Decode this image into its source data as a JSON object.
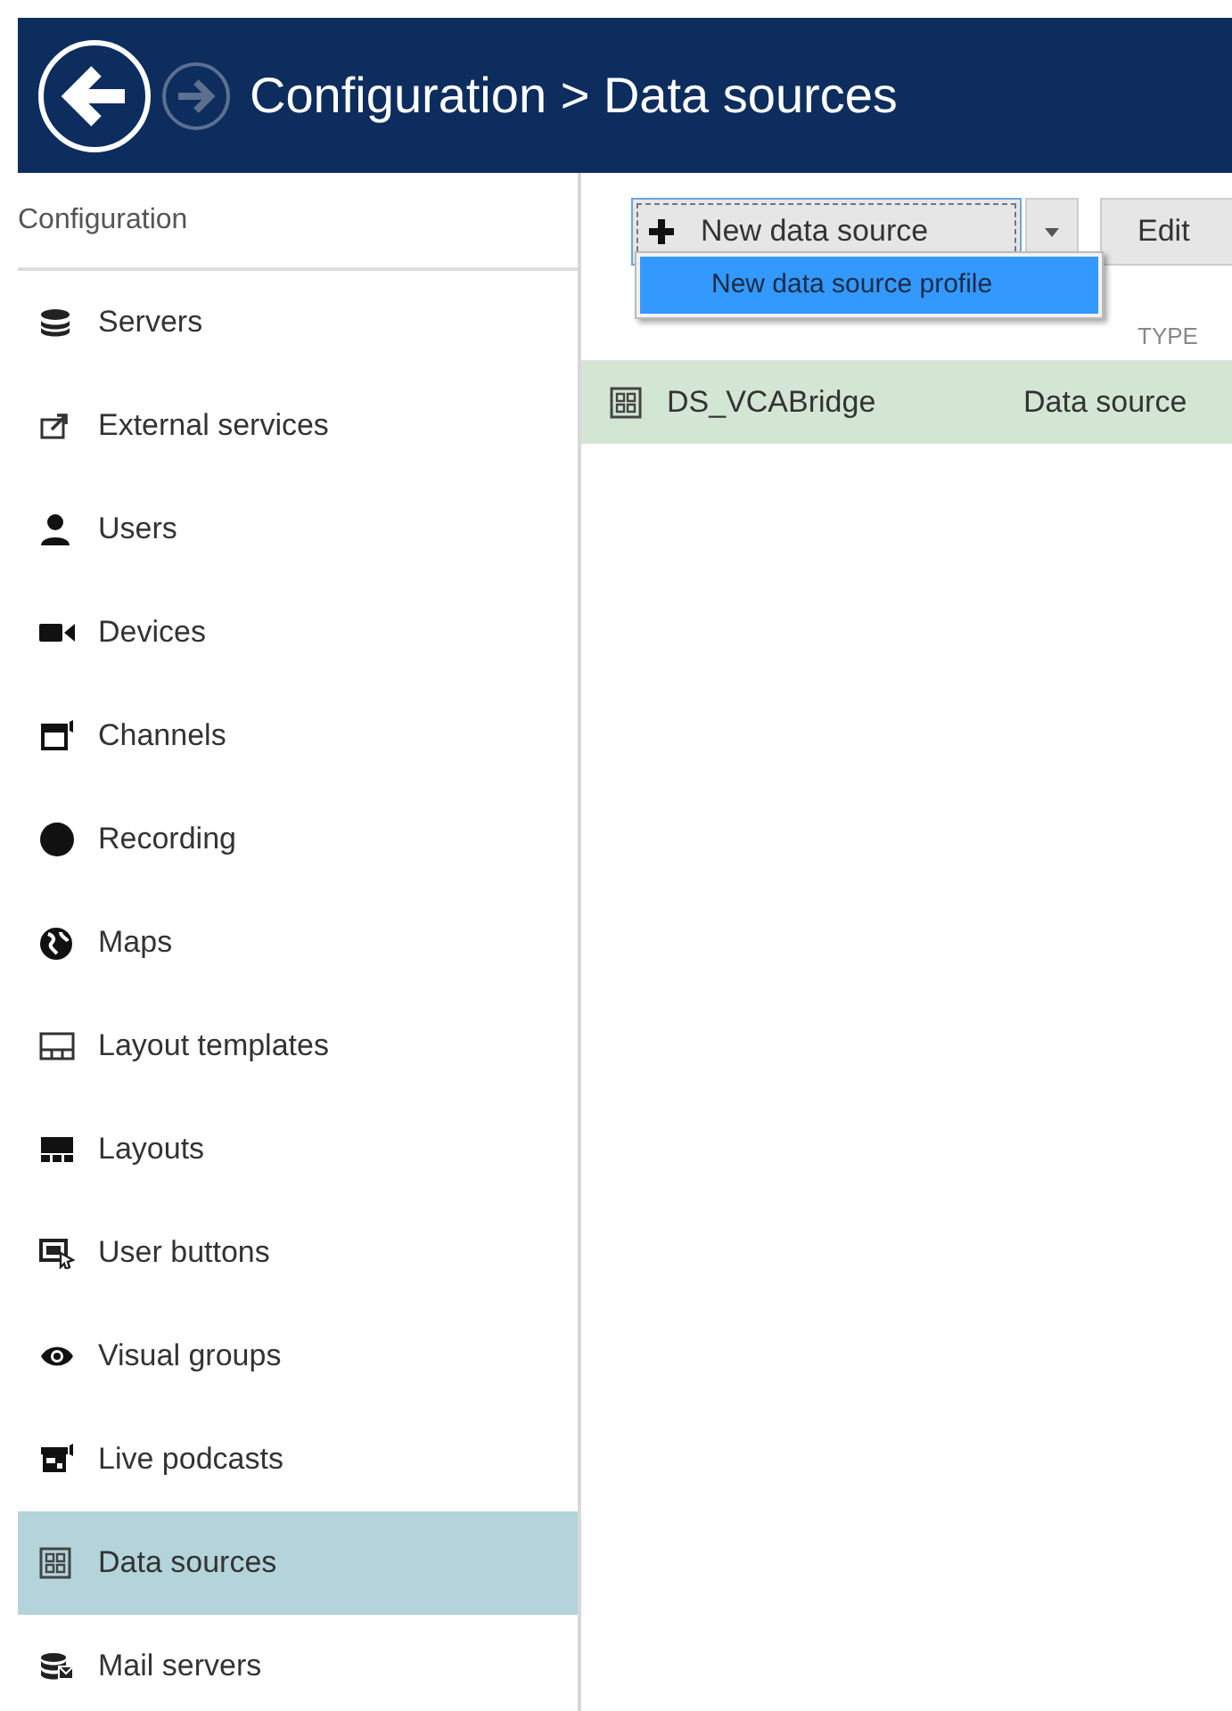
{
  "header": {
    "title": "Configuration > Data sources"
  },
  "sidebar": {
    "title": "Configuration",
    "items": [
      {
        "label": "Servers",
        "selected": false
      },
      {
        "label": "External services",
        "selected": false
      },
      {
        "label": "Users",
        "selected": false
      },
      {
        "label": "Devices",
        "selected": false
      },
      {
        "label": "Channels",
        "selected": false
      },
      {
        "label": "Recording",
        "selected": false
      },
      {
        "label": "Maps",
        "selected": false
      },
      {
        "label": "Layout templates",
        "selected": false
      },
      {
        "label": "Layouts",
        "selected": false
      },
      {
        "label": "User buttons",
        "selected": false
      },
      {
        "label": "Visual groups",
        "selected": false
      },
      {
        "label": "Live podcasts",
        "selected": false
      },
      {
        "label": "Data sources",
        "selected": true
      },
      {
        "label": "Mail servers",
        "selected": false
      }
    ]
  },
  "toolbar": {
    "new_button": "New data source",
    "edit_button": "Edit"
  },
  "dropdown_menu": {
    "items": [
      "New data source profile"
    ]
  },
  "table": {
    "columns": [
      "TYPE"
    ],
    "rows": [
      {
        "name": "DS_VCABridge",
        "type": "Data source",
        "selected": true
      }
    ]
  }
}
